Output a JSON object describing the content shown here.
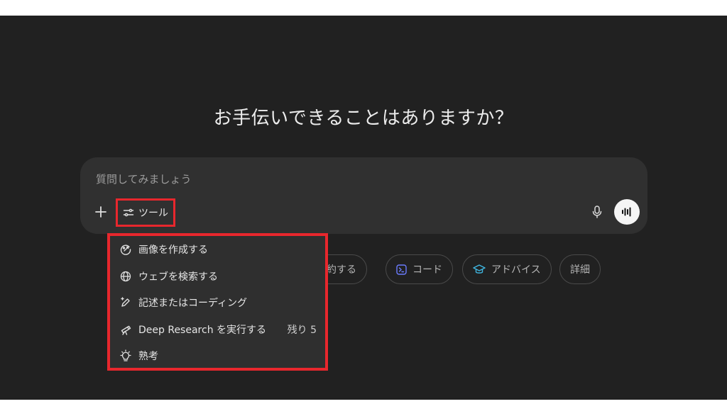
{
  "headline": "お手伝いできることはありますか？",
  "composer": {
    "placeholder": "質問してみましょう",
    "add_icon": "plus-icon",
    "tools_label": "ツール",
    "tools_icon": "sliders-icon",
    "mic_icon": "microphone-icon",
    "voice_icon": "voice-waveform-icon"
  },
  "chips": [
    {
      "label": "要約する",
      "icon": ""
    },
    {
      "label": "コード",
      "icon": "code-terminal-icon"
    },
    {
      "label": "アドバイス",
      "icon": "graduation-cap-icon"
    },
    {
      "label": "詳細",
      "icon": ""
    }
  ],
  "tools_menu": {
    "items": [
      {
        "label": "画像を作成する",
        "icon": "image-create-icon"
      },
      {
        "label": "ウェブを検索する",
        "icon": "globe-icon"
      },
      {
        "label": "記述またはコーディング",
        "icon": "pen-sparkle-icon"
      },
      {
        "label": "Deep Research を実行する",
        "icon": "telescope-icon",
        "badge": "残り 5"
      },
      {
        "label": "熟考",
        "icon": "lightbulb-icon"
      }
    ]
  },
  "colors": {
    "background": "#212121",
    "composer": "#303030",
    "highlight": "#e8272d",
    "code_chip_icon": "#6b7cff",
    "advice_chip_icon": "#3fb6e0"
  }
}
